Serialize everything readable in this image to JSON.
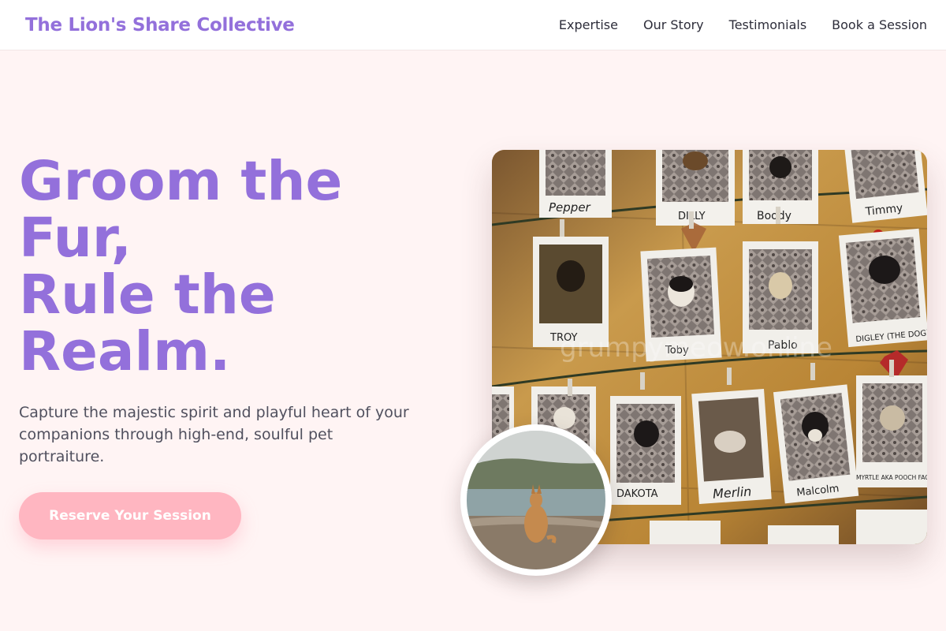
{
  "nav": {
    "brand": "The Lion's Share Collective",
    "links": [
      "Expertise",
      "Our Story",
      "Testimonials",
      "Book a Session"
    ]
  },
  "hero": {
    "title_lines": [
      "Groom the",
      "Fur,",
      "Rule the",
      "Realm."
    ],
    "subtitle": "Capture the majestic spirit and playful heart of your companions through high-end, soulful pet portraiture.",
    "cta_label": "Reserve Your Session"
  },
  "photos": {
    "names": [
      "Pepper",
      "DILLY",
      "Boody",
      "Timmy",
      "TROY",
      "Toby",
      "Pablo",
      "DIGLEY (THE DOG)",
      "DAKOTA",
      "Merlin",
      "Malcolm",
      "MYRTLE AKA POOCH FACE!"
    ],
    "watermark": "grumpymeow.online"
  },
  "colors": {
    "brand": "#9370db",
    "accent": "#ffb6c1",
    "background": "#fff4f4",
    "body_text": "#50505e"
  }
}
